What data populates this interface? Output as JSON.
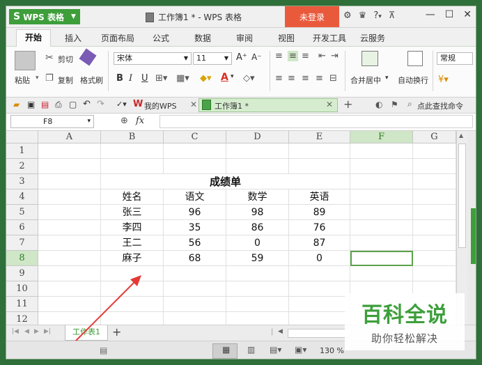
{
  "app": {
    "logo_label": "WPS 表格",
    "document_title": "工作簿1 * - WPS 表格",
    "login_label": "未登录",
    "help_label": "?"
  },
  "ribbon_tabs": [
    "开始",
    "插入",
    "页面布局",
    "公式",
    "数据",
    "审阅",
    "视图",
    "开发工具",
    "云服务"
  ],
  "ribbon": {
    "paste_label": "粘贴",
    "cut_label": "剪切",
    "copy_label": "复制",
    "format_painter_label": "格式刷",
    "font_name": "宋体",
    "font_size": "11",
    "bold": "B",
    "italic": "I",
    "underline": "U",
    "merge_label": "合并居中",
    "wrap_label": "自动换行",
    "number_format": "常规"
  },
  "doc_tabs": {
    "my_wps_label": "我的WPS",
    "workbook_tab_label": "工作簿1 *",
    "find_label": "点此查找命令"
  },
  "formula_bar": {
    "name_box": "F8",
    "fx_label": "fx"
  },
  "sheet": {
    "columns": [
      "A",
      "B",
      "C",
      "D",
      "E",
      "F",
      "G"
    ],
    "rows": [
      "1",
      "2",
      "3",
      "4",
      "5",
      "6",
      "7",
      "8",
      "9",
      "10",
      "11",
      "12"
    ],
    "title": "成绩单",
    "headers": [
      "姓名",
      "语文",
      "数学",
      "英语"
    ],
    "data": [
      [
        "张三",
        "96",
        "98",
        "89"
      ],
      [
        "李四",
        "35",
        "86",
        "76"
      ],
      [
        "王二",
        "56",
        "0",
        "87"
      ],
      [
        "麻子",
        "68",
        "59",
        "0"
      ]
    ],
    "selected_cell": "F8"
  },
  "sheet_tabs": {
    "sheet1_label": "工作表1",
    "add_label": "+"
  },
  "status_bar": {
    "zoom_label": "130 %"
  },
  "watermark": {
    "title": "百科全说",
    "subtitle": "助你轻松解决"
  },
  "colors": {
    "brand_green": "#3e9e3a",
    "login_red": "#e95a3c",
    "selection_green": "#5aa24a"
  }
}
